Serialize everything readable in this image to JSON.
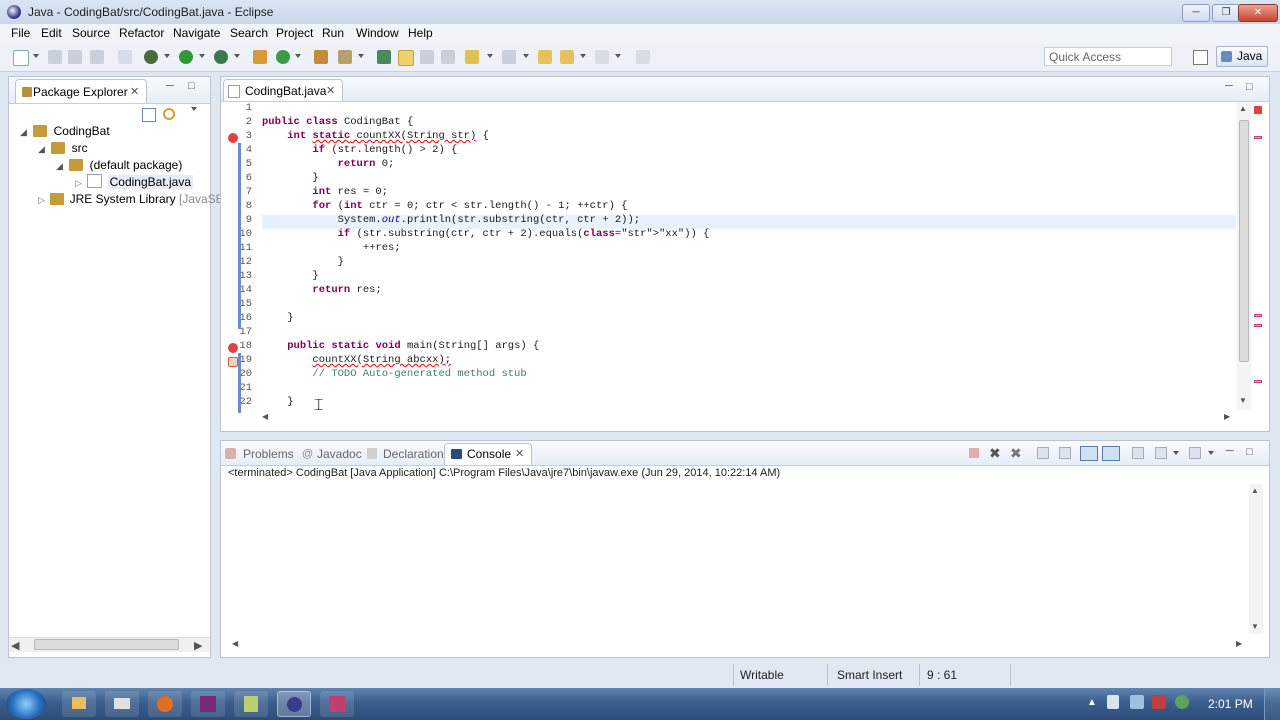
{
  "window": {
    "title": "Java - CodingBat/src/CodingBat.java - Eclipse"
  },
  "menu": [
    "File",
    "Edit",
    "Source",
    "Refactor",
    "Navigate",
    "Search",
    "Project",
    "Run",
    "Window",
    "Help"
  ],
  "toolbar": {
    "quick_access_placeholder": "Quick Access",
    "perspective": "Java"
  },
  "package_explorer": {
    "title": "Package Explorer",
    "tree": [
      {
        "label": "CodingBat",
        "depth": 0,
        "expanded": true
      },
      {
        "label": "src",
        "depth": 1,
        "expanded": true
      },
      {
        "label": "(default package)",
        "depth": 2,
        "expanded": true
      },
      {
        "label": "CodingBat.java",
        "depth": 3,
        "expanded": false,
        "selected": true
      },
      {
        "label": "JRE System Library",
        "suffix": "[JavaSE-",
        "depth": 1,
        "expanded": false
      }
    ]
  },
  "editor": {
    "tab": "CodingBat.java",
    "lines": [
      "",
      "public class CodingBat {",
      "    int static countXX(String str) {",
      "        if (str.length() > 2) {",
      "            return 0;",
      "        }",
      "        int res = 0;",
      "        for (int ctr = 0; ctr < str.length() - 1; ++ctr) {",
      "            System.out.println(str.substring(ctr, ctr + 2));",
      "            if (str.substring(ctr, ctr + 2).equals(\"xx\")) {",
      "                ++res;",
      "            }",
      "        }",
      "        return res;",
      "",
      "    }",
      "",
      "    public static void main(String[] args) {",
      "        countXX(String abcxx);",
      "        // TODO Auto-generated method stub",
      "",
      "    }"
    ],
    "line_numbers": [
      "1",
      "2",
      "3",
      "4",
      "5",
      "6",
      "7",
      "8",
      "9",
      "10",
      "11",
      "12",
      "13",
      "14",
      "15",
      "16",
      "17",
      "18",
      "19",
      "20",
      "21",
      "22"
    ]
  },
  "bottom_panel": {
    "tabs": [
      {
        "label": "Problems",
        "active": false
      },
      {
        "label": "Javadoc",
        "active": false
      },
      {
        "label": "Declaration",
        "active": false
      },
      {
        "label": "Console",
        "active": true
      }
    ],
    "console_text": "<terminated> CodingBat [Java Application] C:\\Program Files\\Java\\jre7\\bin\\javaw.exe (Jun 29, 2014, 10:22:14 AM)"
  },
  "status": {
    "writable": "Writable",
    "insert_mode": "Smart Insert",
    "position": "9 : 61"
  },
  "taskbar": {
    "clock": "2:01 PM"
  },
  "colors": {
    "keyword": "#7f0055",
    "string": "#2a00ff",
    "comment": "#3f7f5f",
    "error": "#e00000"
  }
}
